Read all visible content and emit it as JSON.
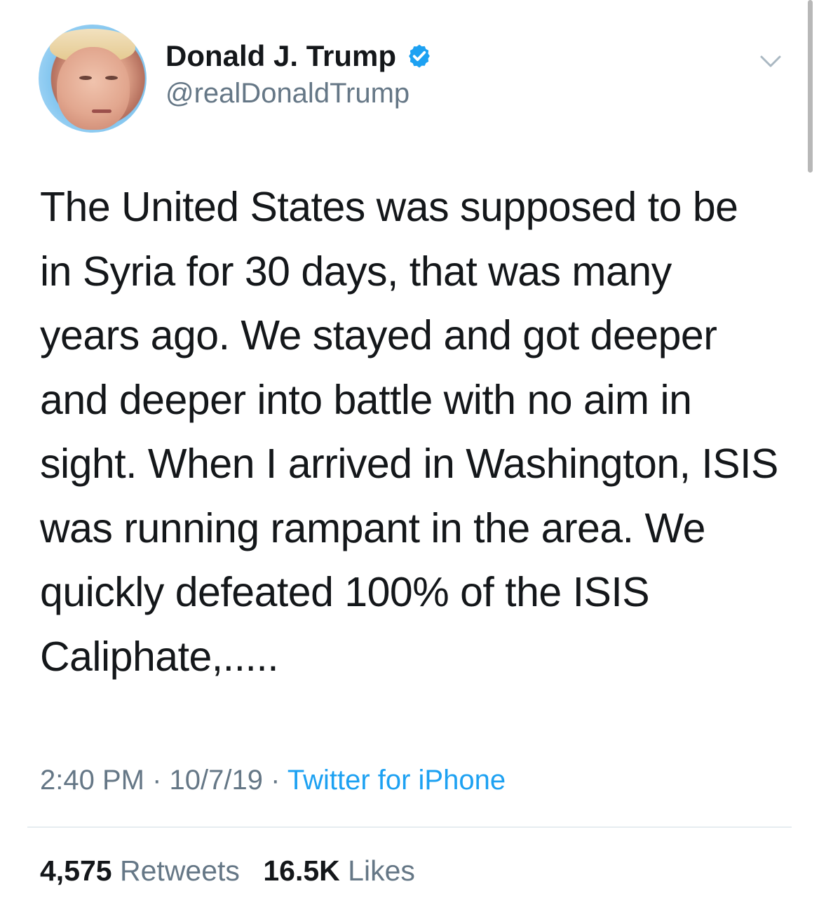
{
  "tweet": {
    "author": {
      "display_name": "Donald J. Trump",
      "handle": "@realDonaldTrump",
      "verified": true,
      "avatar_icon": "profile-photo-avatar"
    },
    "text": "The United States was supposed to be\nin Syria for 30 days, that was many\nyears ago. We stayed and got deeper\nand deeper into battle with no aim in\nsight. When I arrived in Washington, ISIS\nwas running rampant in the area. We\nquickly defeated 100% of the ISIS\nCaliphate,.....",
    "time": "2:40 PM",
    "date": "10/7/19",
    "source": "Twitter for iPhone",
    "retweets": {
      "count": "4,575",
      "label": "Retweets"
    },
    "likes": {
      "count": "16.5K",
      "label": "Likes"
    }
  },
  "icons": {
    "verified": "verified-badge-icon",
    "menu": "chevron-down-icon"
  },
  "colors": {
    "text": "#14171a",
    "muted": "#657786",
    "accent": "#1da1f2",
    "divider": "#e6ecf0"
  }
}
